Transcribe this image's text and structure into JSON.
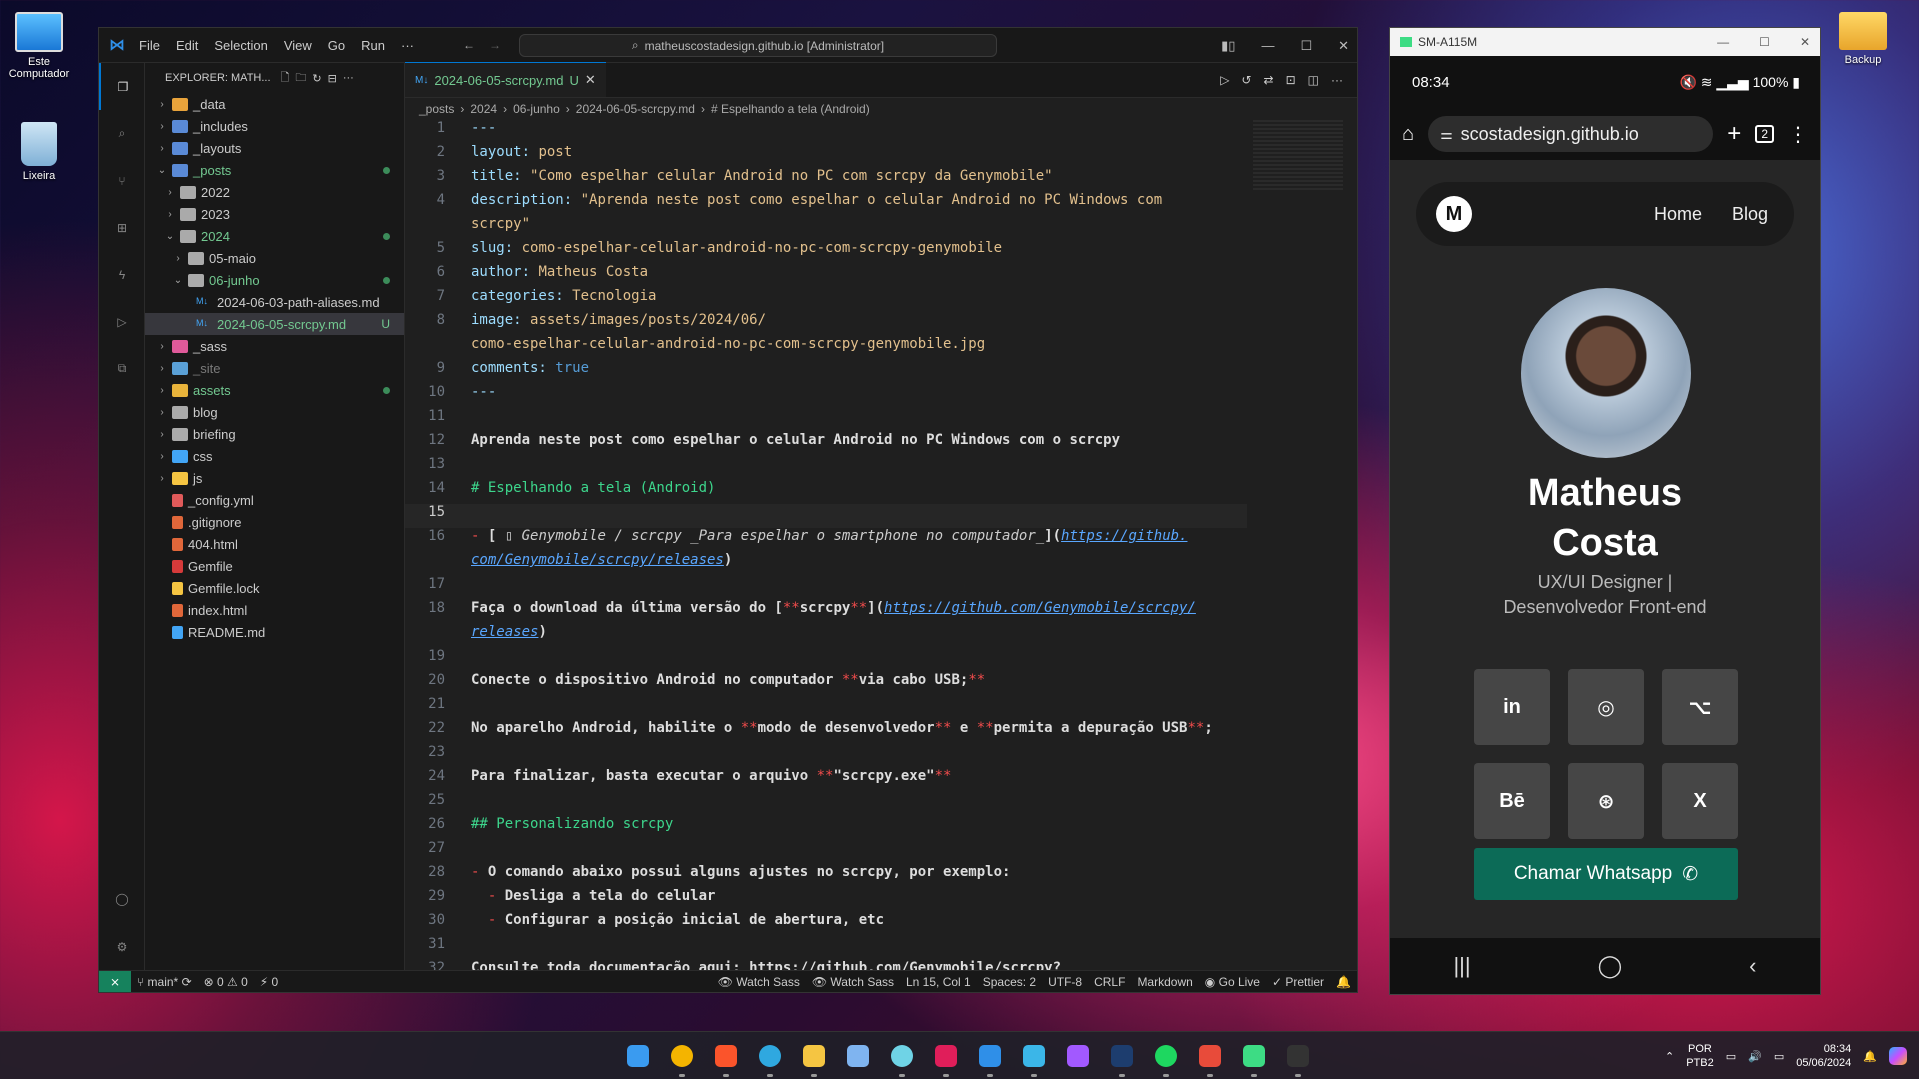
{
  "desktop": {
    "icons": [
      {
        "label": "Este Computador"
      },
      {
        "label": "Lixeira"
      },
      {
        "label": "Backup"
      }
    ]
  },
  "vscode": {
    "menu": [
      "File",
      "Edit",
      "Selection",
      "View",
      "Go",
      "Run",
      "···"
    ],
    "command_center": "matheuscostadesign.github.io [Administrator]",
    "explorer_title": "EXPLORER: MATH...",
    "tree": [
      {
        "label": "_data",
        "type": "folder",
        "depth": 0,
        "open": false,
        "color": "#e8a33b"
      },
      {
        "label": "_includes",
        "type": "folder",
        "depth": 0,
        "open": false,
        "color": "#5a8ad6"
      },
      {
        "label": "_layouts",
        "type": "folder",
        "depth": 0,
        "open": false,
        "color": "#5a8ad6"
      },
      {
        "label": "_posts",
        "type": "folder",
        "depth": 0,
        "open": true,
        "color": "#5a8ad6",
        "dot": true,
        "modified": true
      },
      {
        "label": "2022",
        "type": "folder",
        "depth": 1,
        "open": false,
        "color": "#aaaaaa"
      },
      {
        "label": "2023",
        "type": "folder",
        "depth": 1,
        "open": false,
        "color": "#aaaaaa"
      },
      {
        "label": "2024",
        "type": "folder",
        "depth": 1,
        "open": true,
        "color": "#aaaaaa",
        "dot": true,
        "modified": true
      },
      {
        "label": "05-maio",
        "type": "folder",
        "depth": 2,
        "open": false,
        "color": "#aaaaaa"
      },
      {
        "label": "06-junho",
        "type": "folder",
        "depth": 2,
        "open": true,
        "color": "#aaaaaa",
        "dot": true,
        "modified": true
      },
      {
        "label": "2024-06-03-path-aliases.md",
        "type": "md",
        "depth": 3
      },
      {
        "label": "2024-06-05-scrcpy.md",
        "type": "md",
        "depth": 3,
        "selected": true,
        "badge": "U",
        "modified": true
      },
      {
        "label": "_sass",
        "type": "folder",
        "depth": 0,
        "open": false,
        "color": "#e05a9a"
      },
      {
        "label": "_site",
        "type": "folder",
        "depth": 0,
        "open": false,
        "color": "#5aa0d6",
        "dim": true
      },
      {
        "label": "assets",
        "type": "folder",
        "depth": 0,
        "open": false,
        "color": "#e8b33b",
        "dot": true,
        "modified": true
      },
      {
        "label": "blog",
        "type": "folder",
        "depth": 0,
        "open": false,
        "color": "#aaaaaa"
      },
      {
        "label": "briefing",
        "type": "folder",
        "depth": 0,
        "open": false,
        "color": "#aaaaaa"
      },
      {
        "label": "css",
        "type": "folder",
        "depth": 0,
        "open": false,
        "color": "#42a5f5"
      },
      {
        "label": "js",
        "type": "folder",
        "depth": 0,
        "open": false,
        "color": "#f5c542"
      },
      {
        "label": "_config.yml",
        "type": "file",
        "depth": 0,
        "color": "#e05a5a"
      },
      {
        "label": ".gitignore",
        "type": "file",
        "depth": 0,
        "color": "#e0673a"
      },
      {
        "label": "404.html",
        "type": "file",
        "depth": 0,
        "color": "#e0673a"
      },
      {
        "label": "Gemfile",
        "type": "file",
        "depth": 0,
        "color": "#d63a3a"
      },
      {
        "label": "Gemfile.lock",
        "type": "file",
        "depth": 0,
        "color": "#f5c542"
      },
      {
        "label": "index.html",
        "type": "file",
        "depth": 0,
        "color": "#e0673a"
      },
      {
        "label": "README.md",
        "type": "file",
        "depth": 0,
        "color": "#42a5f5"
      }
    ],
    "tab": {
      "label": "2024-06-05-scrcpy.md",
      "badge": "U"
    },
    "breadcrumb": [
      "_posts",
      "2024",
      "06-junho",
      "2024-06-05-scrcpy.md",
      "# Espelhando a tela (Android)"
    ],
    "status": {
      "branch": "main*",
      "problems": "⊗ 0 ⚠ 0",
      "ports": "⚡ 0",
      "watch1": "Watch Sass",
      "watch2": "Watch Sass",
      "pos": "Ln 15, Col 1",
      "spaces": "Spaces: 2",
      "enc": "UTF-8",
      "eol": "CRLF",
      "lang": "Markdown",
      "live": "Go Live",
      "prettier": "✓ Prettier"
    }
  },
  "code": [
    {
      "n": "1",
      "h": "<span class='k'>---</span>"
    },
    {
      "n": "2",
      "h": "<span class='k'>layout:</span> <span class='s'>post</span>"
    },
    {
      "n": "3",
      "h": "<span class='k'>title:</span> <span class='s'>\"Como espelhar celular Android no PC com scrcpy da Genymobile\"</span>"
    },
    {
      "n": "4",
      "h": "<span class='k'>description:</span> <span class='s'>\"Aprenda neste post como espelhar o celular Android no PC Windows com</span>"
    },
    {
      "n": "",
      "h": "<span class='s'>scrcpy\"</span>"
    },
    {
      "n": "5",
      "h": "<span class='k'>slug:</span> <span class='s'>como-espelhar-celular-android-no-pc-com-scrcpy-genymobile</span>"
    },
    {
      "n": "6",
      "h": "<span class='k'>author:</span> <span class='s'>Matheus Costa</span>"
    },
    {
      "n": "7",
      "h": "<span class='k'>categories:</span> <span class='s'>Tecnologia</span>"
    },
    {
      "n": "8",
      "h": "<span class='k'>image:</span> <span class='s'>assets/images/posts/2024/06/</span>"
    },
    {
      "n": "",
      "h": "<span class='s'>como-espelhar-celular-android-no-pc-com-scrcpy-genymobile.jpg</span>"
    },
    {
      "n": "9",
      "h": "<span class='k'>comments:</span> <span class='kw'>true</span>"
    },
    {
      "n": "10",
      "h": "<span class='k'>---</span>"
    },
    {
      "n": "11",
      "h": ""
    },
    {
      "n": "12",
      "h": "<span class='b'>Aprenda neste post como espelhar o celular Android no PC Windows com o scrcpy</span>"
    },
    {
      "n": "13",
      "h": ""
    },
    {
      "n": "14",
      "h": "<span class='g'># Espelhando a tela (Android)</span>"
    },
    {
      "n": "15",
      "h": "",
      "active": true
    },
    {
      "n": "16",
      "h": "<span class='red'>-</span> <span class='b'>[</span><span class='it'> ▯ Genymobile / scrcpy _Para espelhar o smartphone no computador_</span><span class='b'>](</span><span class='lnk'>https://github.</span>"
    },
    {
      "n": "",
      "h": "<span class='lnk'>com/Genymobile/scrcpy/releases</span><span class='b'>)</span>"
    },
    {
      "n": "17",
      "h": ""
    },
    {
      "n": "18",
      "h": "<span class='b'>Faça o download da última versão do [</span><span class='red'>**</span><span class='b'>scrcpy</span><span class='red'>**</span><span class='b'>](</span><span class='lnk'>https://github.com/Genymobile/scrcpy/</span>"
    },
    {
      "n": "",
      "h": "<span class='lnk'>releases</span><span class='b'>)</span>"
    },
    {
      "n": "19",
      "h": ""
    },
    {
      "n": "20",
      "h": "<span class='b'>Conecte o dispositivo Android no computador </span><span class='red'>**</span><span class='b'>via cabo USB;</span><span class='red'>**</span>"
    },
    {
      "n": "21",
      "h": ""
    },
    {
      "n": "22",
      "h": "<span class='b'>No aparelho Android, habilite o </span><span class='red'>**</span><span class='b'>modo de desenvolvedor</span><span class='red'>**</span><span class='b'> e </span><span class='red'>**</span><span class='b'>permita a depuração USB</span><span class='red'>**</span><span class='b'>;</span>"
    },
    {
      "n": "23",
      "h": ""
    },
    {
      "n": "24",
      "h": "<span class='b'>Para finalizar, basta executar o arquivo </span><span class='red'>**</span><span class='b'>\"scrcpy.exe\"</span><span class='red'>**</span>"
    },
    {
      "n": "25",
      "h": ""
    },
    {
      "n": "26",
      "h": "<span class='g'>## Personalizando scrcpy</span>"
    },
    {
      "n": "27",
      "h": ""
    },
    {
      "n": "28",
      "h": "<span class='red'>-</span><span class='b'> O comando abaixo possui alguns ajustes no scrcpy, por exemplo:</span>"
    },
    {
      "n": "29",
      "h": "<span class='red'>  -</span><span class='b'> Desliga a tela do celular</span>"
    },
    {
      "n": "30",
      "h": "<span class='red'>  -</span><span class='b'> Configurar a posição inicial de abertura, etc</span>"
    },
    {
      "n": "31",
      "h": ""
    },
    {
      "n": "32",
      "h": "<span class='b'>Consulte toda documentação aqui: https://github.com/Genymobile/scrcpy?</span>"
    }
  ],
  "phone": {
    "window_title": "SM-A115M",
    "time": "08:34",
    "battery": "100%",
    "url": "scostadesign.github.io",
    "tab_count": "2",
    "logo": "M",
    "nav": [
      "Home",
      "Blog"
    ],
    "name_line1": "Matheus",
    "name_line2": "Costa",
    "role_line1": "UX/UI Designer |",
    "role_line2": "Desenvolvedor Front-end",
    "social": [
      "in",
      "◎",
      "⌥",
      "Bē",
      "⊛",
      "X"
    ],
    "whatsapp": "Chamar Whatsapp"
  },
  "taskbar": {
    "apps": [
      {
        "name": "windows-start",
        "color": "#3a9bf0"
      },
      {
        "name": "chrome",
        "color": "#f4b400"
      },
      {
        "name": "brave",
        "color": "#fb542b"
      },
      {
        "name": "edge",
        "color": "#2fa8e0"
      },
      {
        "name": "file-explorer",
        "color": "#f5c542"
      },
      {
        "name": "notepad",
        "color": "#7fb4f0"
      },
      {
        "name": "chat",
        "color": "#6fd3e6"
      },
      {
        "name": "slack",
        "color": "#e01e5a"
      },
      {
        "name": "vscode",
        "color": "#2f8fe8"
      },
      {
        "name": "scrcpy",
        "color": "#3bb6e8"
      },
      {
        "name": "figma",
        "color": "#a259ff"
      },
      {
        "name": "photoshop",
        "color": "#1d3d6e"
      },
      {
        "name": "spotify",
        "color": "#1ed760"
      },
      {
        "name": "todo",
        "color": "#e84b3a"
      },
      {
        "name": "android",
        "color": "#3ddc84"
      },
      {
        "name": "terminal",
        "color": "#333333"
      }
    ],
    "lang1": "POR",
    "lang2": "PTB2",
    "clock": "08:34",
    "date": "05/06/2024"
  }
}
